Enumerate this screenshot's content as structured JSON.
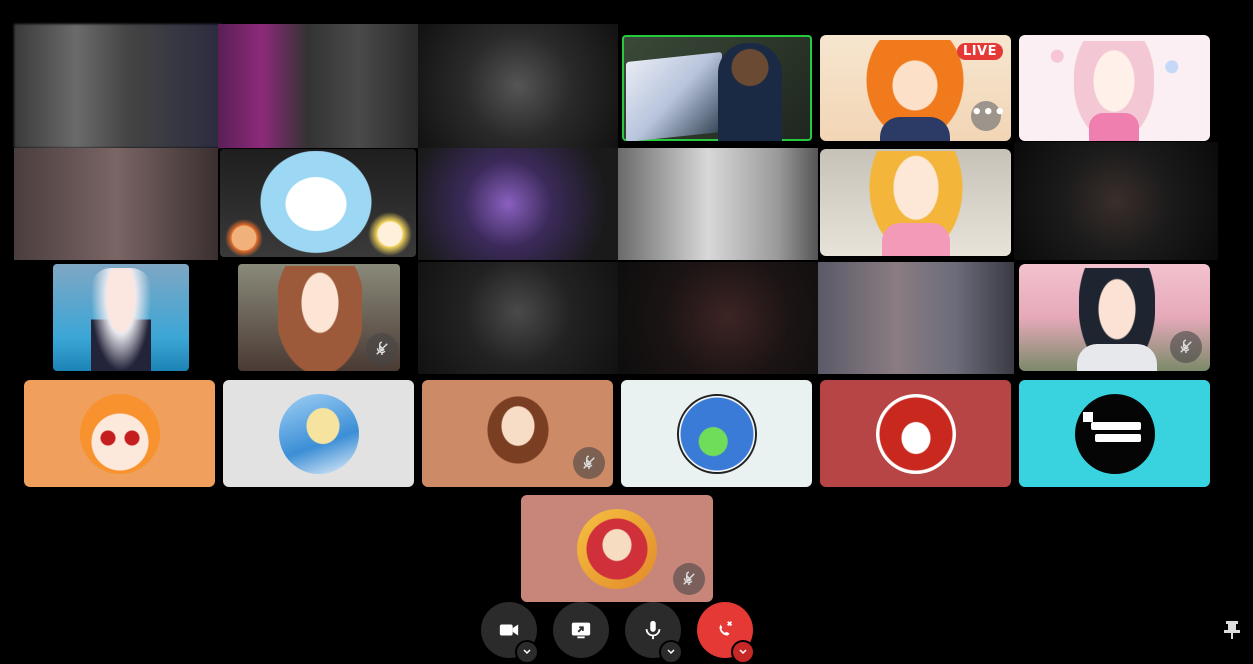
{
  "toolbar": {
    "video_button": "camera",
    "share_button": "screen-share",
    "mic_button": "microphone",
    "end_call_button": "end-call"
  },
  "tiles": {
    "live_badge": "LIVE",
    "more_label": "•••"
  },
  "colors": {
    "accent_green": "#27c93f",
    "end_call_red": "#e53935",
    "tile_orange": "#f0a05c",
    "tile_grey": "#e2e2e2",
    "tile_brown": "#cd8a66",
    "tile_mint": "#e9f1f1",
    "tile_red": "#b84545",
    "tile_cyan": "#39d3df",
    "tile_dusty_pink": "#c8857a"
  }
}
